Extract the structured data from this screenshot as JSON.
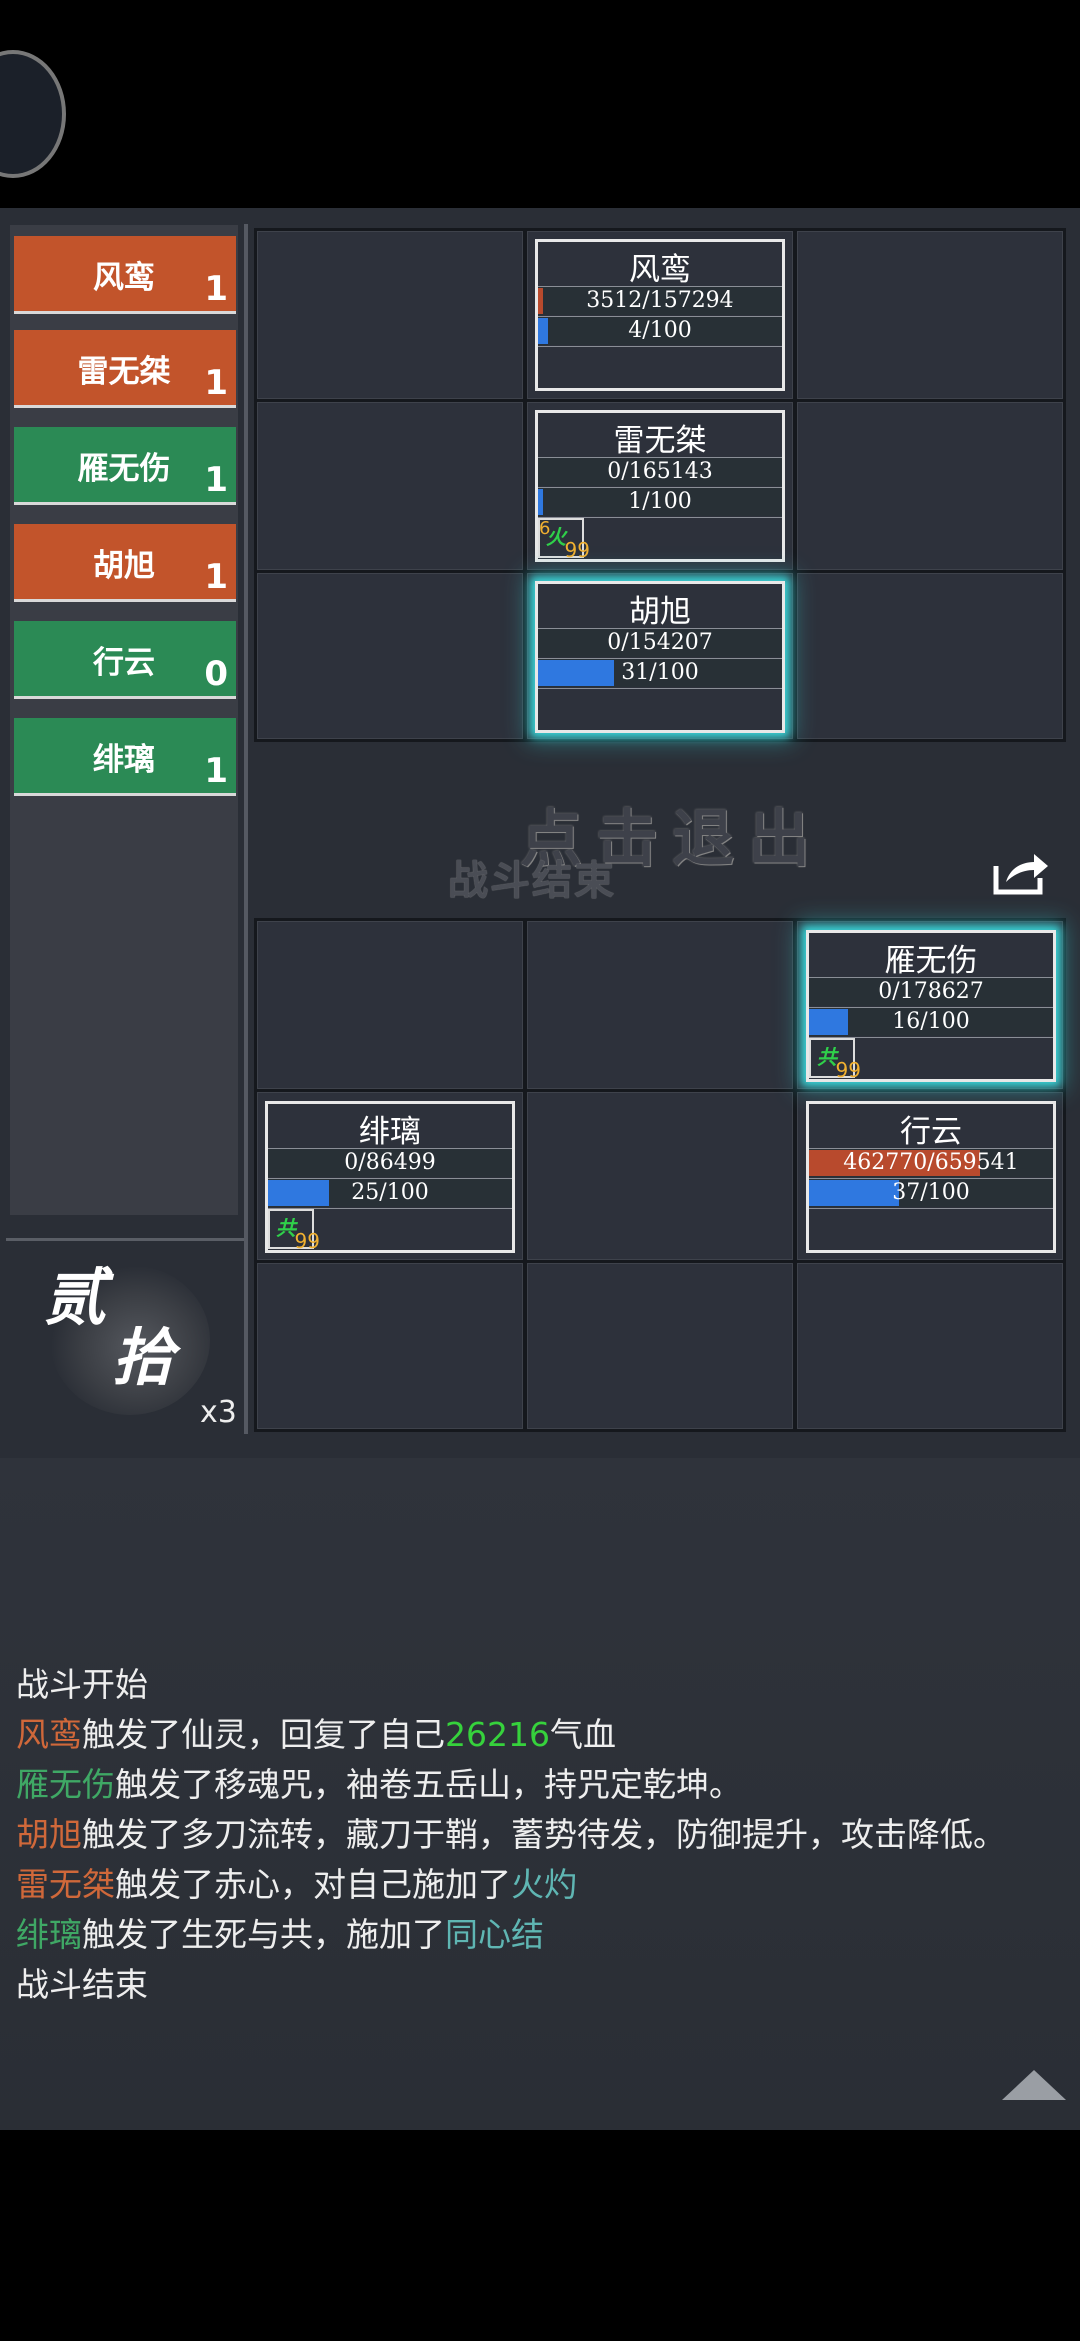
{
  "teams": [
    {
      "name": "风鸾",
      "count": "1",
      "color": "red"
    },
    {
      "name": "雷无桀",
      "count": "1",
      "color": "red"
    },
    {
      "name": "雁无伤",
      "count": "1",
      "color": "green"
    },
    {
      "name": "胡旭",
      "count": "1",
      "color": "red"
    },
    {
      "name": "行云",
      "count": "0",
      "color": "green"
    },
    {
      "name": "绯璃",
      "count": "1",
      "color": "green"
    }
  ],
  "round": {
    "line1": "贰",
    "line2": "拾",
    "speed": "x3"
  },
  "banner": {
    "exit": "点击退出",
    "end": "战斗结束"
  },
  "units": {
    "fengluan": {
      "name": "风鸾",
      "hp": "3512/157294",
      "hp_ratio": 0.022,
      "energy": "4/100",
      "energy_ratio": 0.04
    },
    "leiwujie": {
      "name": "雷无桀",
      "hp": "0/165143",
      "hp_ratio": 0,
      "energy": "1/100",
      "energy_ratio": 0.01,
      "buff_stack": "6",
      "buff_glyph": "火",
      "buff_turns": "99"
    },
    "huxu": {
      "name": "胡旭",
      "hp": "0/154207",
      "hp_ratio": 0,
      "energy": "31/100",
      "energy_ratio": 0.31
    },
    "yanwushang": {
      "name": "雁无伤",
      "hp": "0/178627",
      "hp_ratio": 0,
      "energy": "16/100",
      "energy_ratio": 0.16,
      "buff_glyph": "共",
      "buff_turns": "99"
    },
    "feili": {
      "name": "绯璃",
      "hp": "0/86499",
      "hp_ratio": 0,
      "energy": "25/100",
      "energy_ratio": 0.25,
      "buff_glyph": "共",
      "buff_turns": "99"
    },
    "xingyun": {
      "name": "行云",
      "hp": "462770/659541",
      "hp_ratio": 0.702,
      "energy": "37/100",
      "energy_ratio": 0.37
    }
  },
  "log": [
    {
      "parts": [
        {
          "t": "战斗开始",
          "c": ""
        }
      ]
    },
    {
      "parts": [
        {
          "t": "风鸾",
          "c": "red"
        },
        {
          "t": "触发了仙灵，回复了自己",
          "c": ""
        },
        {
          "t": "26216",
          "c": "num"
        },
        {
          "t": "气血",
          "c": ""
        }
      ]
    },
    {
      "parts": [
        {
          "t": "雁无伤",
          "c": "green"
        },
        {
          "t": "触发了移魂咒，袖卷五岳山，持咒定乾坤。",
          "c": ""
        }
      ]
    },
    {
      "parts": [
        {
          "t": "胡旭",
          "c": "red"
        },
        {
          "t": "触发了多刀流转，藏刀于鞘，蓄势待发，防御提升，攻击降低。",
          "c": ""
        }
      ]
    },
    {
      "parts": [
        {
          "t": "雷无桀",
          "c": "red"
        },
        {
          "t": "触发了赤心，对自己施加了",
          "c": ""
        },
        {
          "t": "火灼",
          "c": "cyan"
        }
      ]
    },
    {
      "parts": [
        {
          "t": "绯璃",
          "c": "green"
        },
        {
          "t": "触发了生死与共，施加了",
          "c": ""
        },
        {
          "t": "同心结",
          "c": "cyan"
        }
      ]
    },
    {
      "parts": [
        {
          "t": "战斗结束",
          "c": ""
        }
      ]
    }
  ],
  "icons": {
    "share": "share-icon",
    "collapse": "collapse-arrow-icon"
  },
  "colors": {
    "red_team": "#c2542b",
    "green_team": "#2b8a55",
    "highlight": "#3ad3d6",
    "hp_bar": "#b84a2d",
    "energy_bar": "#2f78e0"
  }
}
